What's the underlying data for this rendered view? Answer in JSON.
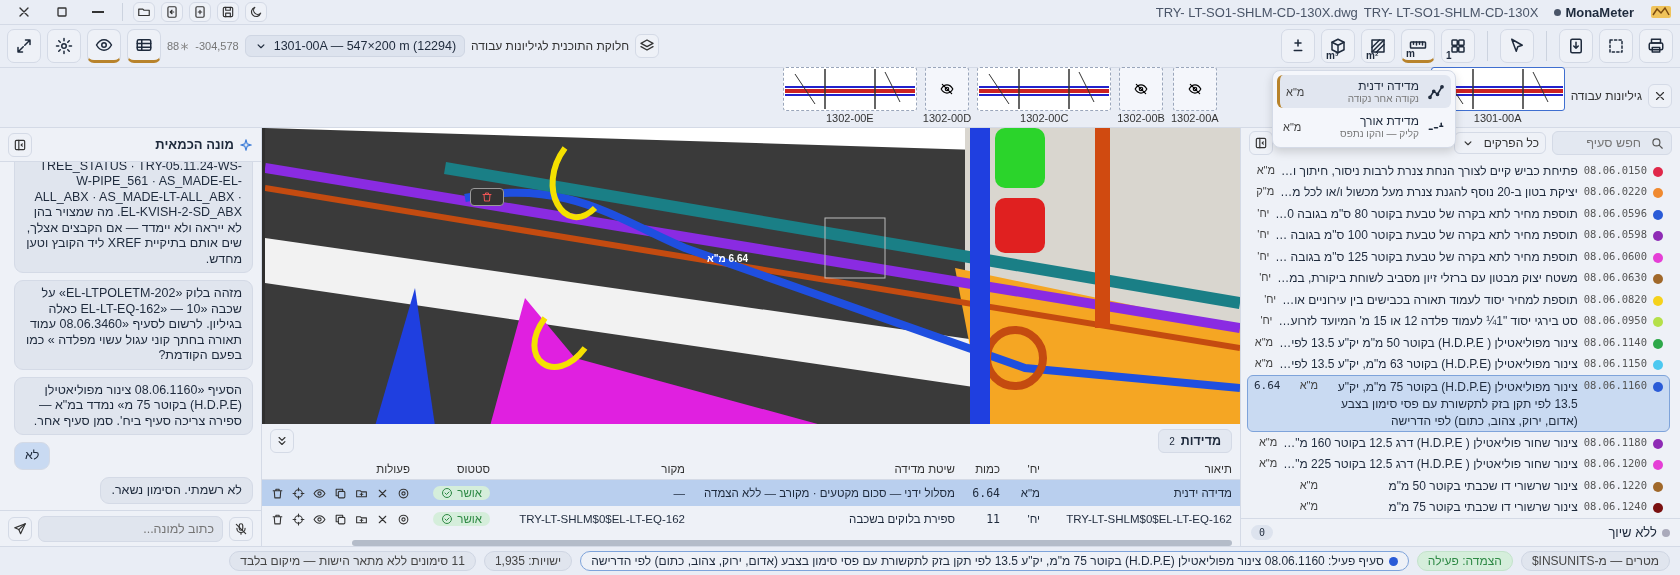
{
  "title_bar": {
    "file_name": "TRY- LT-SO1-SHLM-CD-130X.dwg",
    "document": "TRY- LT-SO1-SHLM-CD-130X",
    "modified": true,
    "app_name": "MonaMeter"
  },
  "toolbar": {
    "view_buttons": [
      {
        "kind": "table",
        "active": true
      },
      {
        "kind": "eye",
        "active": true
      },
      {
        "kind": "settings",
        "active": false
      },
      {
        "kind": "expand",
        "active": false
      }
    ],
    "snow_count": "88",
    "coordinate": "304,578-",
    "sheet_select": "1301-00A — 547×200 m (12294)",
    "sheet_label": "חלוקת התוכנית לגיליונות עבודה",
    "tools": [
      {
        "kind": "print",
        "active": false
      },
      {
        "kind": "select",
        "active": false
      },
      {
        "kind": "download",
        "active": false
      },
      {
        "kind": "separator"
      },
      {
        "kind": "pointer",
        "active": false
      },
      {
        "kind": "separator"
      },
      {
        "kind": "grid",
        "badge": "1",
        "active": false
      },
      {
        "kind": "ruler",
        "badge": "m",
        "active": true
      },
      {
        "kind": "hatch",
        "badge": "m²",
        "active": false
      },
      {
        "kind": "cube",
        "badge": "m³",
        "active": false
      },
      {
        "kind": "plusminus",
        "active": false
      }
    ]
  },
  "sheets": {
    "label": "גיליונות עבודה",
    "items": [
      {
        "label": "1301-00A",
        "hidden": false,
        "selected": true
      },
      {
        "label": "1302-00A",
        "hidden": true,
        "selected": false
      },
      {
        "label": "1302-00B",
        "hidden": true,
        "selected": false
      },
      {
        "label": "1302-00C",
        "hidden": false,
        "selected": false
      },
      {
        "label": "1302-00D",
        "hidden": true,
        "selected": false
      },
      {
        "label": "1302-00E",
        "hidden": false,
        "selected": false
      }
    ]
  },
  "measure_menu": {
    "items": [
      {
        "kind": "route",
        "title": "מדידה ידנית",
        "hint": "נקודה אחר נקודה",
        "unit": "מ\"א",
        "selected": true
      },
      {
        "kind": "line",
        "title": "מדידת אורך",
        "hint": "קליק — והקו נתפס",
        "unit": "מ\"א",
        "selected": false
      }
    ]
  },
  "items_panel": {
    "search_placeholder": "חפש סעיף",
    "chapter_select": "כל הפרקים",
    "rows": [
      {
        "code": "08.06.0150",
        "color": "#e0284a",
        "text": "פתיחת כביש קיים לצורך הנחת צנרת לרבות ניסור, חיתוך ו…",
        "unit": "מ\"א",
        "selected": false
      },
      {
        "code": "08.06.0220",
        "color": "#f08a30",
        "text": "יציקת בטון ב-20 נוסף להגנת צנרת מעל מכשול ו/או לכל מ…",
        "unit": "מ\"ק",
        "selected": false
      },
      {
        "code": "08.06.0596",
        "color": "#2a5bd7",
        "text": "תוספת מחיר לתא בקרה של טבעת בקוטר 80 ס\"מ בגובה 0…",
        "unit": "יח'",
        "selected": false
      },
      {
        "code": "08.06.0598",
        "color": "#8e2bb5",
        "text": "תוספת מחיר לתא בקרה של טבעת בקוטר 100 ס\"מ בגובה …",
        "unit": "יח'",
        "selected": false
      },
      {
        "code": "08.06.0600",
        "color": "#e53fd6",
        "text": "תוספת מחיר לתא בקרה של טבעת בקוטר 125 ס\"מ בגובה …",
        "unit": "יח'",
        "selected": false
      },
      {
        "code": "08.06.0630",
        "color": "#a0682a",
        "text": "משטח יצוק מבטון עם ברזלי זיון מסביב לשוחת ביקורת, במ…",
        "unit": "יח'",
        "selected": false
      },
      {
        "code": "08.06.0820",
        "color": "#f5d21c",
        "text": "תוספת למחיר יסוד לעמוד תאורה בכבישים בין עירוניים או…",
        "unit": "יח'",
        "selected": false
      },
      {
        "code": "08.06.0950",
        "color": "#b5e04a",
        "text": "סט בירגי יסוד \"1¼ לעמוד פלדה 12 או 15 מ' המיועד לזרוע…",
        "unit": "יח'",
        "selected": false
      },
      {
        "code": "08.06.1140",
        "color": "#2ea84a",
        "text": "צינור מפוליאטילן ( H.D.P.E) בקוטר 50 מ\"מ יק\"ע 13.5 לפי…",
        "unit": "מ\"א",
        "selected": false
      },
      {
        "code": "08.06.1150",
        "color": "#4cc8f0",
        "text": "צינור מפוליאטילן (H.D.P.E) בקוטר 63 מ\"מ, יק\"ע 13.5 לפי…",
        "unit": "מ\"א",
        "selected": false
      },
      {
        "code": "08.06.1160",
        "color": "#2a5bd7",
        "text": "צינור מפוליאטילן (H.D.P.E) בקוטר 75 מ\"מ, יק\"ע 13.5 לפי תקן בזק לתקשורת עם פסי סימון בצבע (אדום, ירוק, צהוב, כתום) לפי הדרישה",
        "unit": "מ\"א",
        "qty": "6.64",
        "selected": true
      },
      {
        "code": "08.06.1180",
        "color": "#8e2bb5",
        "text": "צינור שחור פוליאטילן ( H.D.P.E) דרג 12.5 בקוטר 160 מ\"…",
        "unit": "מ\"א",
        "selected": false
      },
      {
        "code": "08.06.1200",
        "color": "#e53fd6",
        "text": "צינור שחור פוליאטילן ( H.D.P.E) דרג 12.5 בקוטר 225 מ\"…",
        "unit": "מ\"א",
        "selected": false
      },
      {
        "code": "08.06.1220",
        "color": "#a0682a",
        "text": "צינור שרשורי דו שכבתי בקוטר 50 מ\"מ",
        "unit": "מ\"א",
        "selected": false
      },
      {
        "code": "08.06.1240",
        "color": "#7a1010",
        "text": "צינור שרשורי דו שכבתי בקוטר 75 מ\"מ",
        "unit": "מ\"א",
        "selected": false
      }
    ],
    "unassigned_label": "ללא שיוך",
    "unassigned_count": "0"
  },
  "canvas": {
    "measure_label": "6.64 מ\"א"
  },
  "measurements": {
    "tab_label": "מדידות",
    "count": "2",
    "columns": [
      "תיאור",
      "יח'",
      "כמות",
      "שיטת מדידה",
      "מקור",
      "סטטוס",
      "פעולות"
    ],
    "rows": [
      {
        "description": "מדידה ידנית",
        "unit": "מ\"א",
        "qty": "6.64",
        "method": "מסלול ידני — סכום מקטעים · מקורב — ללא הצמדה",
        "source": "—",
        "status": "אושר",
        "selected": true
      },
      {
        "description": "TRY-LT-SHLM$0$EL-LT-EQ-162",
        "unit": "יח'",
        "qty": "11",
        "method": "ספירת בלוקים בשכבה",
        "source": "TRY-LT-SHLM$0$EL-LT-EQ-162",
        "status": "אושר",
        "selected": false
      }
    ]
  },
  "chat": {
    "title": "מונה הכמאית",
    "placeholder": "כתוב למונה...",
    "messages": [
      {
        "kind": "assistant",
        "text": "TREE_STATUS · TRY-05.11.24-WS-W-PIPE_561 · AS_MADE-EL-ALL_ABX · AS_MADE-LT-ALL_ABX · EL-KVISH-2-SD_ABX. מה שמצויר בהן לא ייראה ולא יימדד — אם הקבצים אצלך, שים אותם בתיקיית XREF ליד הקובץ וטען מחדש."
      },
      {
        "kind": "assistant",
        "text": "מזהה בלוק «EL-LTPOLETM-202» על שכבה «10 — «EL-LT-EQ-162 כאלה בגיליון. לרשום לסעיף «08.06.3460 עמוד תאורה בחתך קוני עגול עשוי מפלדה » כמו בפעם הקודמת?"
      },
      {
        "kind": "assistant",
        "text": "הסעיף «08.06.1160 צינור מפוליאטילן (H.D.P.E) בקוטר 75 מ» נמדד במ\"א — ספירה צריכה סעיף ביח'. סמן סעיף אחר."
      },
      {
        "kind": "user",
        "text": "לא"
      },
      {
        "kind": "assistant",
        "text": "לא רשמתי. הסימון נשאר."
      }
    ]
  },
  "status_bar": [
    {
      "kind": "plain",
      "text": "מטרים — מ-INSUNITS$"
    },
    {
      "kind": "good",
      "text": "הצמדה: פעילה"
    },
    {
      "kind": "active",
      "text": "סעיף פעיל: 08.06.1160 צינור מפוליאטילן (H.D.P.E) בקוטר 75 מ\"מ, יק\"ע 13.5 לפי תקן בזק לתקשורת עם פסי סימון בצבע (אדום, ירוק, צהוב, כתום) לפי הדרישה",
      "color": "#2a5bd7"
    },
    {
      "kind": "plain",
      "text": "ישויות: 1,935"
    },
    {
      "kind": "plain",
      "text": "11 סימונים ללא מתאר הישות — מיקום בלבד"
    }
  ]
}
